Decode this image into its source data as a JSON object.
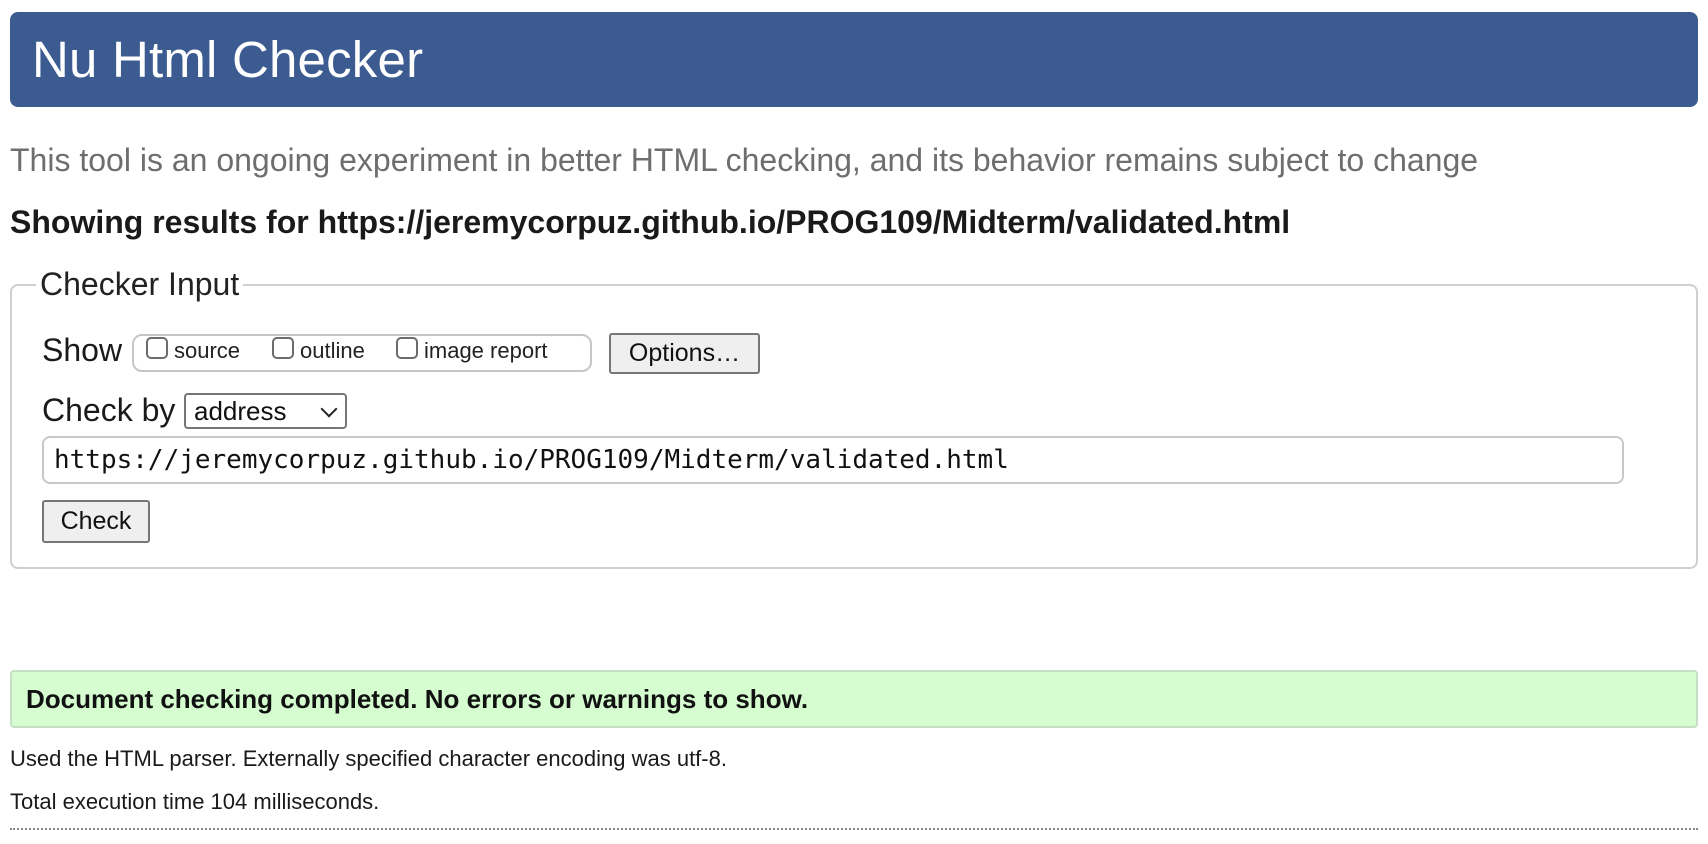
{
  "header": {
    "title": "Nu Html Checker"
  },
  "subtitle": "This tool is an ongoing experiment in better HTML checking, and its behavior remains subject to change",
  "results_heading": "Showing results for https://jeremycorpuz.github.io/PROG109/Midterm/validated.html",
  "checker_input": {
    "legend": "Checker Input",
    "show_label": "Show",
    "show_options": [
      {
        "label": "source",
        "checked": false
      },
      {
        "label": "outline",
        "checked": false
      },
      {
        "label": "image report",
        "checked": false
      }
    ],
    "options_button": "Options…",
    "check_by_label": "Check by",
    "check_by_selected": "address",
    "url_value": "https://jeremycorpuz.github.io/PROG109/Midterm/validated.html",
    "check_button": "Check"
  },
  "status": {
    "message": "Document checking completed. No errors or warnings to show.",
    "color": "#d5fdd0"
  },
  "info": {
    "parser": "Used the HTML parser. Externally specified character encoding was utf-8.",
    "execution_time": "Total execution time 104 milliseconds."
  },
  "colors": {
    "header_bg": "#3c5c91",
    "subtitle_text": "#6e6e6e"
  }
}
